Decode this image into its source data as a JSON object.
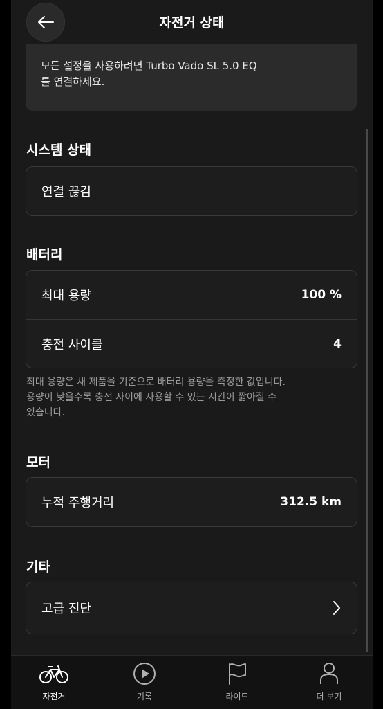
{
  "header": {
    "title": "자전거 상태",
    "back_icon": "arrow-left-icon"
  },
  "notice": {
    "line1": "모든 설정을 사용하려면 Turbo Vado SL 5.0 EQ",
    "line2": "를 연결하세요."
  },
  "system": {
    "title": "시스템 상태",
    "status": "연결 끊김"
  },
  "battery": {
    "title": "배터리",
    "rows": [
      {
        "label": "최대 용량",
        "value": "100 %"
      },
      {
        "label": "충전 사이클",
        "value": "4"
      }
    ],
    "note_line1": "최대 용량은 새 제품을 기준으로 배터리 용량을 측정한 값입니다.",
    "note_line2": "용량이 낮을수록 충전 사이에 사용할 수 있는 시간이 짧아질 수",
    "note_line3": "있습니다."
  },
  "motor": {
    "title": "모터",
    "odometer_label": "누적 주행거리",
    "odometer_value": "312.5 km"
  },
  "other": {
    "title": "기타",
    "advanced_label": "고급 진단",
    "chevron_icon": "chevron-right-icon"
  },
  "tabbar": {
    "items": [
      {
        "label": "자전거",
        "icon": "bicycle-icon",
        "active": true
      },
      {
        "label": "기록",
        "icon": "play-circle-icon",
        "active": false
      },
      {
        "label": "라이드",
        "icon": "flag-icon",
        "active": false
      },
      {
        "label": "더 보기",
        "icon": "person-icon",
        "active": false
      }
    ]
  },
  "colors": {
    "background": "#1a1a1a",
    "card_border": "#3a3a3a",
    "text": "#ffffff",
    "muted_text": "#9a9a9a"
  }
}
